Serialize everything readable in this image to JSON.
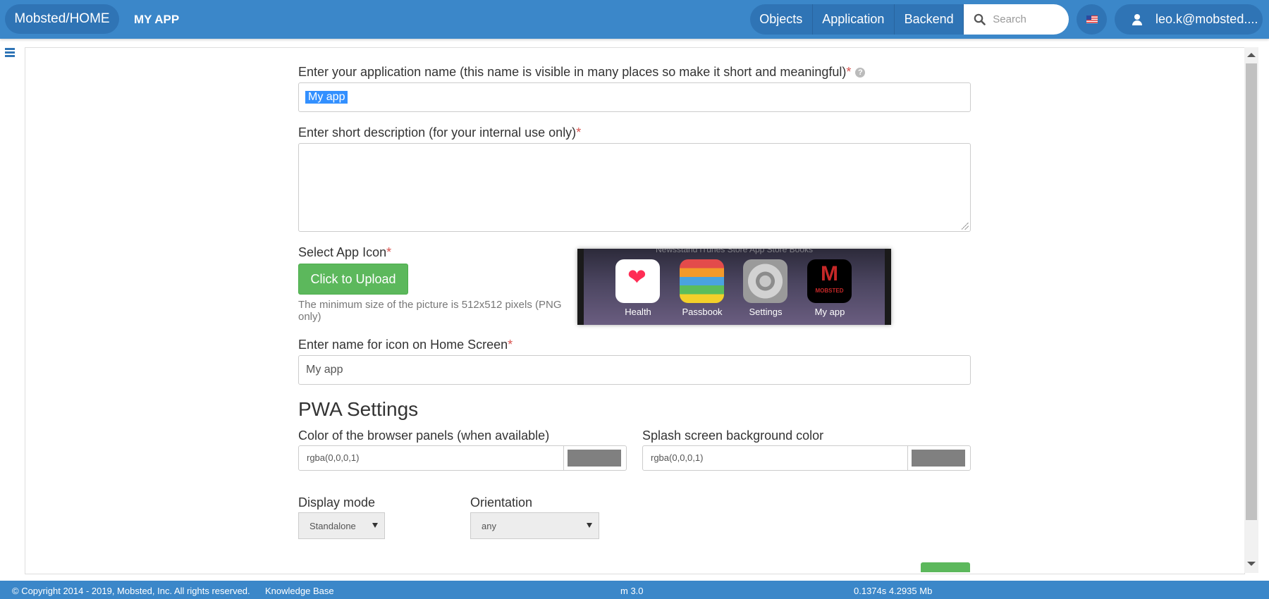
{
  "header": {
    "brand": "Mobsted/HOME",
    "app_title": "MY APP",
    "nav": {
      "objects": "Objects",
      "application": "Application",
      "backend": "Backend"
    },
    "search_placeholder": "Search",
    "user_email": "leo.k@mobsted...."
  },
  "form": {
    "app_name_label": "Enter your application name (this name is visible in many places so make it short and meaningful)",
    "app_name_value": "My app",
    "description_label": "Enter short description (for your internal use only)",
    "description_value": "",
    "icon_label": "Select App Icon",
    "upload_button": "Click to Upload",
    "icon_hint": "The minimum size of the picture is 512x512 pixels (PNG only)",
    "preview": {
      "top_labels": "Newsstand   iTunes Store   App Store   Books",
      "apps": [
        "Health",
        "Passbook",
        "Settings",
        "My app"
      ],
      "myapp_logo_text": "MOBSTED"
    },
    "homescreen_label": "Enter name for icon on Home Screen",
    "homescreen_value": "My app",
    "required_mark": "*",
    "help_mark": "?"
  },
  "pwa": {
    "title": "PWA Settings",
    "panel_color_label": "Color of the browser panels (when available)",
    "panel_color_value": "rgba(0,0,0,1)",
    "splash_color_label": "Splash screen background color",
    "splash_color_value": "rgba(0,0,0,1)",
    "display_mode_label": "Display mode",
    "display_mode_value": "Standalone",
    "orientation_label": "Orientation",
    "orientation_value": "any"
  },
  "footer": {
    "copyright": "© Copyright 2014 - 2019, Mobsted, Inc. All rights reserved.",
    "kb_link": "Knowledge Base",
    "version": "m 3.0",
    "perf": "0.1374s 4.2935 Mb"
  },
  "colors": {
    "primary": "#3b87c9",
    "primary_dark": "#2f74b5",
    "success": "#5cb85c",
    "required": "#d9534f",
    "swatch": "#808080"
  }
}
